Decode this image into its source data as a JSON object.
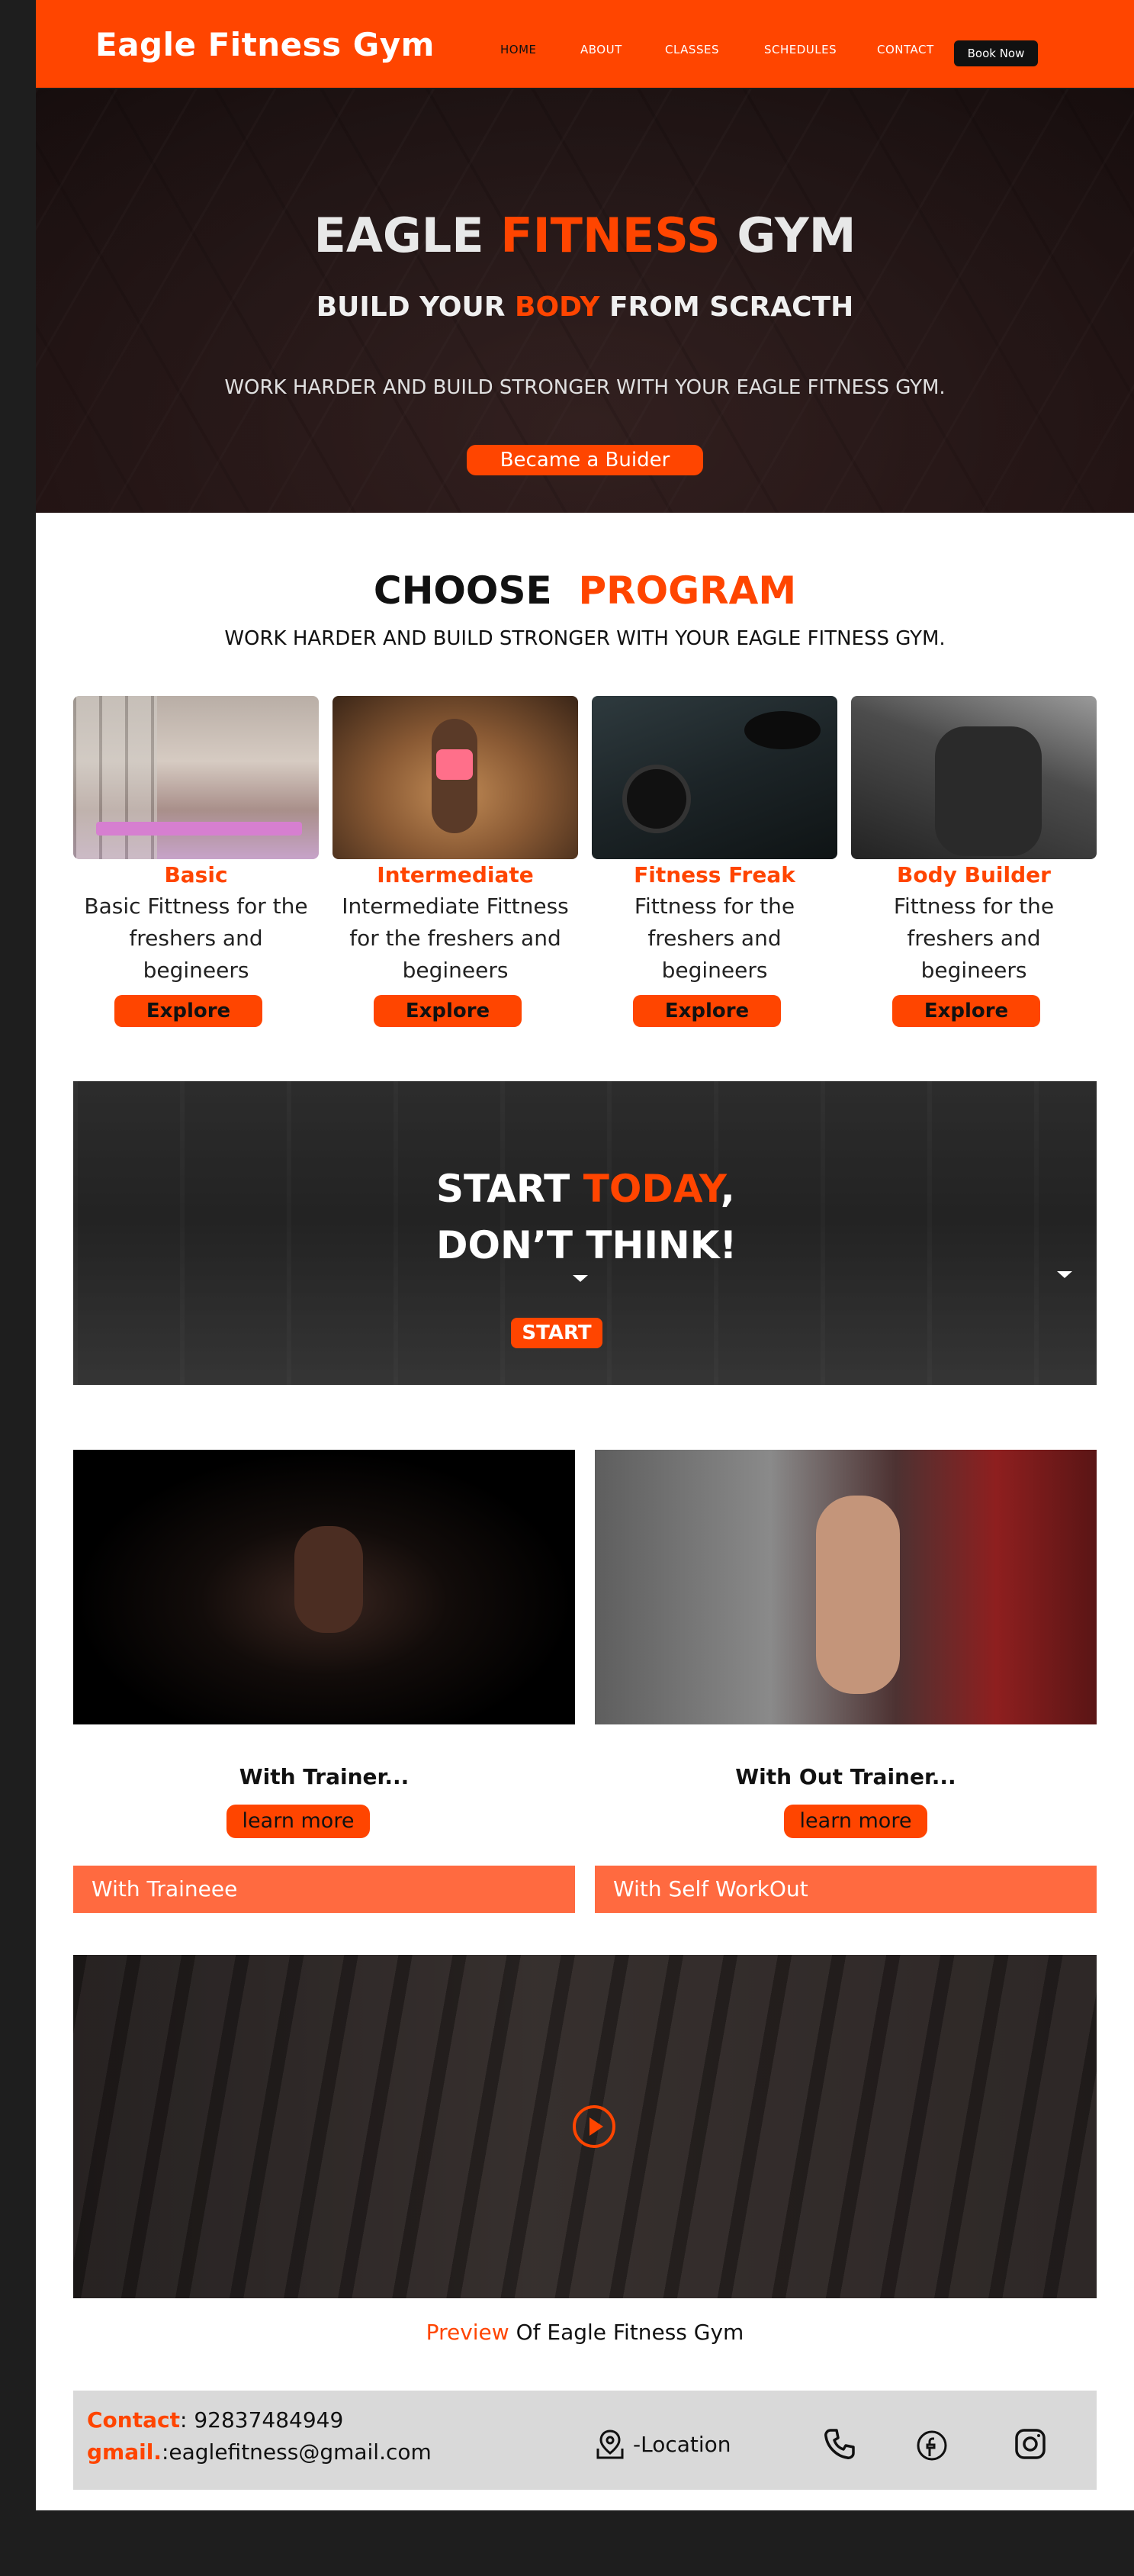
{
  "header": {
    "brand": "Eagle Fitness Gym",
    "nav": [
      "HOME",
      "ABOUT",
      "CLASSES",
      "SCHEDULES",
      "CONTACT"
    ],
    "book_label": "Book Now"
  },
  "hero": {
    "title_a": "EAGLE",
    "title_accent": "FITNESS",
    "title_b": "GYM",
    "sub_a": "BUILD YOUR",
    "sub_accent": "BODY",
    "sub_b": "FROM SCRACTH",
    "tagline": "WORK HARDER AND BUILD STRONGER WITH  YOUR EAGLE  FITNESS GYM.",
    "cta": "Became a Buider"
  },
  "program": {
    "title_a": "CHOOSE",
    "title_accent": "PROGRAM",
    "tagline": "WORK HARDER AND BUILD STRONGER WITH  YOUR EAGLE  FITNESS GYM.",
    "cards": [
      {
        "name": "Basic",
        "desc": "Basic Fittness for the freshers  and begineers",
        "button": "Explore"
      },
      {
        "name": "Intermediate",
        "desc": "Intermediate Fittness for the freshers  and begineers",
        "button": "Explore"
      },
      {
        "name": "Fitness Freak",
        "desc": "Fittness for the freshers  and begineers",
        "button": "Explore"
      },
      {
        "name": "Body Builder",
        "desc": "Fittness for the freshers  and begineers",
        "button": "Explore"
      }
    ]
  },
  "banner": {
    "line1_a": "START",
    "line1_accent": "TODAY",
    "line1_b": ",",
    "line2": "DON’T THINK!",
    "button": "START"
  },
  "trainer": {
    "with": {
      "label": "With Trainer...",
      "button": "learn more",
      "bar": "With Traineee"
    },
    "without": {
      "label": "With Out Trainer...",
      "button": "learn more",
      "bar": "With Self WorkOut"
    }
  },
  "preview": {
    "accent": "Preview",
    "rest": "Of Eagle Fitness Gym"
  },
  "footer": {
    "contact_key": "Contact",
    "contact_val": ": 92837484949",
    "gmail_key": "gmail.",
    "gmail_val": ":eaglefitness@gmail.com",
    "location": "-Location"
  },
  "colors": {
    "accent": "#ff4500",
    "bar": "#ff6a40",
    "footer_bg": "#d9d9d9"
  },
  "icons": [
    "location-pin-icon",
    "phone-icon",
    "facebook-icon",
    "instagram-icon",
    "play-icon"
  ]
}
